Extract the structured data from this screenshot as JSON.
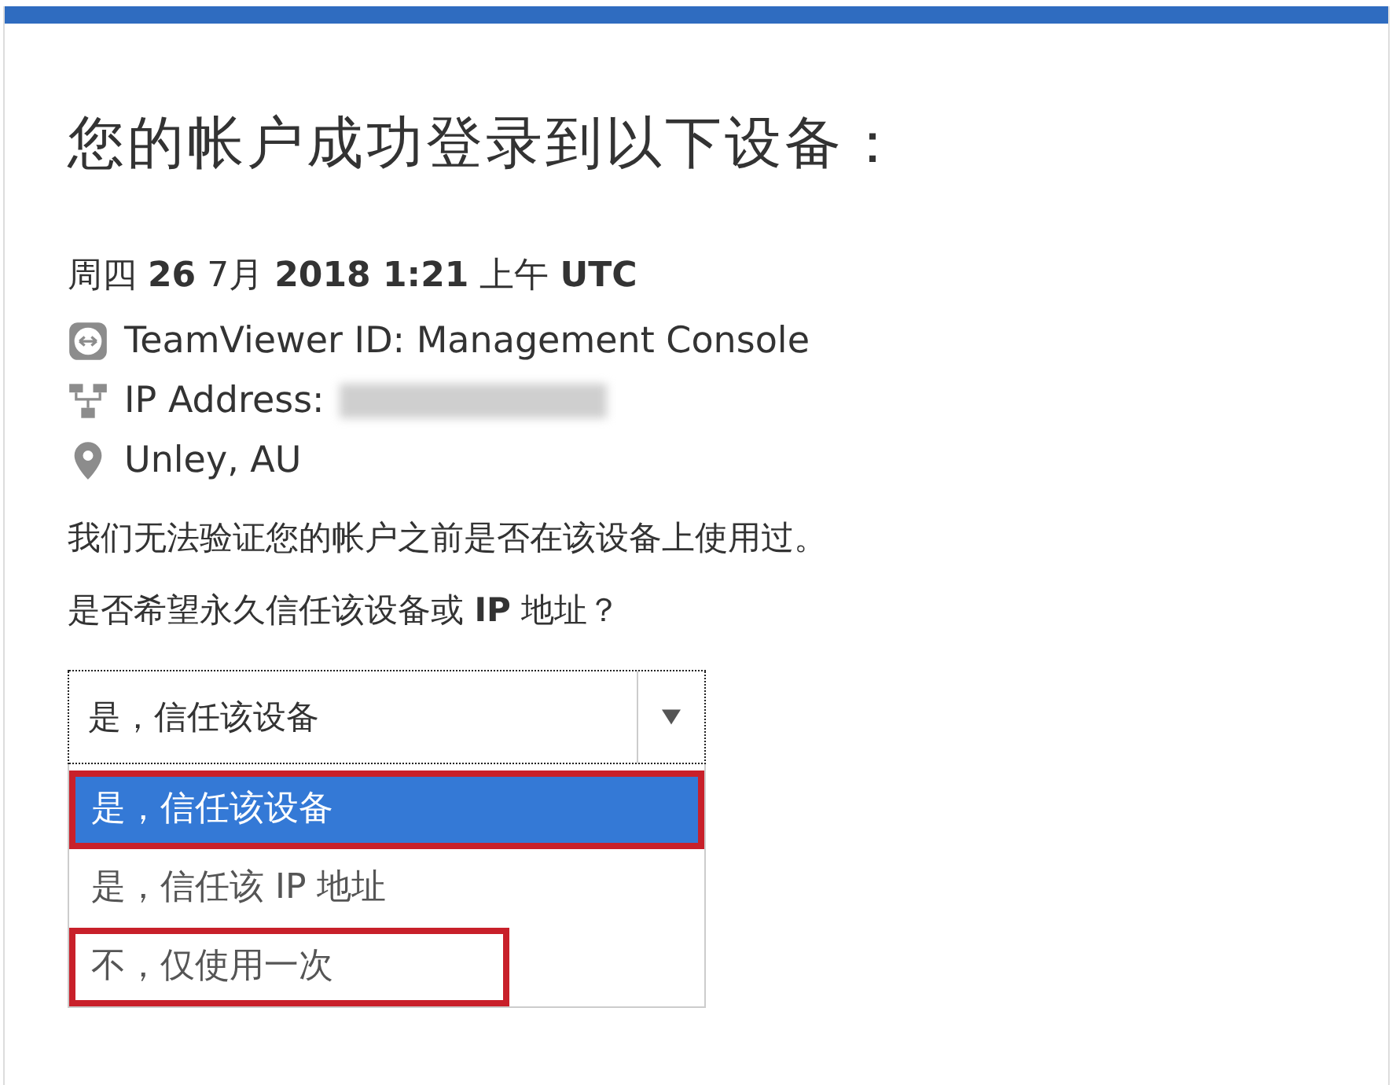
{
  "heading": "您的帐户成功登录到以下设备：",
  "login_time": "周四 **26** 7月 **2018 1:21** 上午 **UTC**",
  "details": [
    {
      "kind": "device",
      "label": "TeamViewer ID: Management Console"
    },
    {
      "kind": "network",
      "label": "IP Address:",
      "redacted": true
    },
    {
      "kind": "location",
      "label": "Unley, AU"
    }
  ],
  "notice": "我们无法验证您的帐户之前是否在该设备上使用过。",
  "question": "是否希望永久信任该设备或 **IP** 地址？",
  "select": {
    "value": "是，信任该设备",
    "expanded": true,
    "options": [
      {
        "label": "是，信任该设备",
        "selected": true,
        "highlighted": true
      },
      {
        "label": "是，信任该 IP 地址",
        "selected": false,
        "highlighted": false
      },
      {
        "label": "不，仅使用一次",
        "selected": false,
        "highlighted": true
      }
    ]
  }
}
